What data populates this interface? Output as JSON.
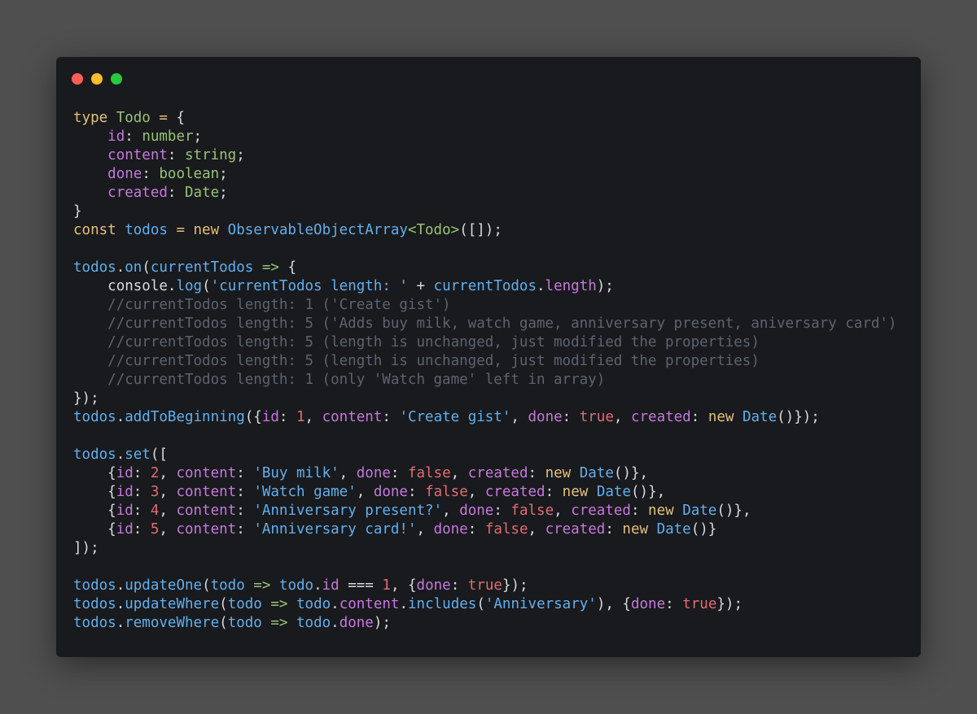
{
  "window": {
    "controls": [
      {
        "name": "close",
        "color": "#ff5f57"
      },
      {
        "name": "minimize",
        "color": "#febc2e"
      },
      {
        "name": "maximize",
        "color": "#28c840"
      }
    ]
  },
  "code": {
    "lines": [
      [
        [
          "kw",
          "type "
        ],
        [
          "tp",
          "Todo"
        ],
        [
          "kw",
          " = "
        ],
        [
          "pun",
          "{"
        ]
      ],
      [
        [
          "pun",
          "    "
        ],
        [
          "prop",
          "id"
        ],
        [
          "pun",
          ": "
        ],
        [
          "tp",
          "number"
        ],
        [
          "pun",
          ";"
        ]
      ],
      [
        [
          "pun",
          "    "
        ],
        [
          "prop",
          "content"
        ],
        [
          "pun",
          ": "
        ],
        [
          "tp",
          "string"
        ],
        [
          "pun",
          ";"
        ]
      ],
      [
        [
          "pun",
          "    "
        ],
        [
          "prop",
          "done"
        ],
        [
          "pun",
          ": "
        ],
        [
          "tp",
          "boolean"
        ],
        [
          "pun",
          ";"
        ]
      ],
      [
        [
          "pun",
          "    "
        ],
        [
          "prop",
          "created"
        ],
        [
          "pun",
          ": "
        ],
        [
          "tp",
          "Date"
        ],
        [
          "pun",
          ";"
        ]
      ],
      [
        [
          "pun",
          "}"
        ]
      ],
      [
        [
          "kw",
          "const "
        ],
        [
          "var",
          "todos"
        ],
        [
          "kw",
          " = new "
        ],
        [
          "cls",
          "ObservableObjectArray"
        ],
        [
          "op",
          "<"
        ],
        [
          "tp",
          "Todo"
        ],
        [
          "op",
          ">"
        ],
        [
          "pun",
          "([]);"
        ]
      ],
      [],
      [
        [
          "var",
          "todos"
        ],
        [
          "pun",
          "."
        ],
        [
          "fn",
          "on"
        ],
        [
          "pun",
          "("
        ],
        [
          "var",
          "currentTodos"
        ],
        [
          "op",
          " => "
        ],
        [
          "pun",
          "{"
        ]
      ],
      [
        [
          "pun",
          "    "
        ],
        [
          "txt",
          "console"
        ],
        [
          "pun",
          "."
        ],
        [
          "fn",
          "log"
        ],
        [
          "pun",
          "("
        ],
        [
          "str",
          "'currentTodos length: '"
        ],
        [
          "pun",
          " + "
        ],
        [
          "var",
          "currentTodos"
        ],
        [
          "pun",
          "."
        ],
        [
          "prop",
          "length"
        ],
        [
          "pun",
          ");"
        ]
      ],
      [
        [
          "pun",
          "    "
        ],
        [
          "com",
          "//currentTodos length: 1 ('Create gist')"
        ]
      ],
      [
        [
          "pun",
          "    "
        ],
        [
          "com",
          "//currentTodos length: 5 ('Adds buy milk, watch game, anniversary present, aniversary card')"
        ]
      ],
      [
        [
          "pun",
          "    "
        ],
        [
          "com",
          "//currentTodos length: 5 (length is unchanged, just modified the properties)"
        ]
      ],
      [
        [
          "pun",
          "    "
        ],
        [
          "com",
          "//currentTodos length: 5 (length is unchanged, just modified the properties)"
        ]
      ],
      [
        [
          "pun",
          "    "
        ],
        [
          "com",
          "//currentTodos length: 1 (only 'Watch game' left in array)"
        ]
      ],
      [
        [
          "pun",
          "});"
        ]
      ],
      [
        [
          "var",
          "todos"
        ],
        [
          "pun",
          "."
        ],
        [
          "fn",
          "addToBeginning"
        ],
        [
          "pun",
          "({"
        ],
        [
          "prop",
          "id"
        ],
        [
          "pun",
          ": "
        ],
        [
          "num",
          "1"
        ],
        [
          "pun",
          ", "
        ],
        [
          "prop",
          "content"
        ],
        [
          "pun",
          ": "
        ],
        [
          "str",
          "'Create gist'"
        ],
        [
          "pun",
          ", "
        ],
        [
          "prop",
          "done"
        ],
        [
          "pun",
          ": "
        ],
        [
          "bool",
          "true"
        ],
        [
          "pun",
          ", "
        ],
        [
          "prop",
          "created"
        ],
        [
          "pun",
          ": "
        ],
        [
          "kw",
          "new "
        ],
        [
          "cls",
          "Date"
        ],
        [
          "pun",
          "()});"
        ]
      ],
      [],
      [
        [
          "var",
          "todos"
        ],
        [
          "pun",
          "."
        ],
        [
          "fn",
          "set"
        ],
        [
          "pun",
          "(["
        ]
      ],
      [
        [
          "pun",
          "    {"
        ],
        [
          "prop",
          "id"
        ],
        [
          "pun",
          ": "
        ],
        [
          "num",
          "2"
        ],
        [
          "pun",
          ", "
        ],
        [
          "prop",
          "content"
        ],
        [
          "pun",
          ": "
        ],
        [
          "str",
          "'Buy milk'"
        ],
        [
          "pun",
          ", "
        ],
        [
          "prop",
          "done"
        ],
        [
          "pun",
          ": "
        ],
        [
          "bool",
          "false"
        ],
        [
          "pun",
          ", "
        ],
        [
          "prop",
          "created"
        ],
        [
          "pun",
          ": "
        ],
        [
          "kw",
          "new "
        ],
        [
          "cls",
          "Date"
        ],
        [
          "pun",
          "()},"
        ]
      ],
      [
        [
          "pun",
          "    {"
        ],
        [
          "prop",
          "id"
        ],
        [
          "pun",
          ": "
        ],
        [
          "num",
          "3"
        ],
        [
          "pun",
          ", "
        ],
        [
          "prop",
          "content"
        ],
        [
          "pun",
          ": "
        ],
        [
          "str",
          "'Watch game'"
        ],
        [
          "pun",
          ", "
        ],
        [
          "prop",
          "done"
        ],
        [
          "pun",
          ": "
        ],
        [
          "bool",
          "false"
        ],
        [
          "pun",
          ", "
        ],
        [
          "prop",
          "created"
        ],
        [
          "pun",
          ": "
        ],
        [
          "kw",
          "new "
        ],
        [
          "cls",
          "Date"
        ],
        [
          "pun",
          "()},"
        ]
      ],
      [
        [
          "pun",
          "    {"
        ],
        [
          "prop",
          "id"
        ],
        [
          "pun",
          ": "
        ],
        [
          "num",
          "4"
        ],
        [
          "pun",
          ", "
        ],
        [
          "prop",
          "content"
        ],
        [
          "pun",
          ": "
        ],
        [
          "str",
          "'Anniversary present?'"
        ],
        [
          "pun",
          ", "
        ],
        [
          "prop",
          "done"
        ],
        [
          "pun",
          ": "
        ],
        [
          "bool",
          "false"
        ],
        [
          "pun",
          ", "
        ],
        [
          "prop",
          "created"
        ],
        [
          "pun",
          ": "
        ],
        [
          "kw",
          "new "
        ],
        [
          "cls",
          "Date"
        ],
        [
          "pun",
          "()},"
        ]
      ],
      [
        [
          "pun",
          "    {"
        ],
        [
          "prop",
          "id"
        ],
        [
          "pun",
          ": "
        ],
        [
          "num",
          "5"
        ],
        [
          "pun",
          ", "
        ],
        [
          "prop",
          "content"
        ],
        [
          "pun",
          ": "
        ],
        [
          "str",
          "'Anniversary card!'"
        ],
        [
          "pun",
          ", "
        ],
        [
          "prop",
          "done"
        ],
        [
          "pun",
          ": "
        ],
        [
          "bool",
          "false"
        ],
        [
          "pun",
          ", "
        ],
        [
          "prop",
          "created"
        ],
        [
          "pun",
          ": "
        ],
        [
          "kw",
          "new "
        ],
        [
          "cls",
          "Date"
        ],
        [
          "pun",
          "()}"
        ]
      ],
      [
        [
          "pun",
          "]);"
        ]
      ],
      [],
      [
        [
          "var",
          "todos"
        ],
        [
          "pun",
          "."
        ],
        [
          "fn",
          "updateOne"
        ],
        [
          "pun",
          "("
        ],
        [
          "var",
          "todo"
        ],
        [
          "op",
          " => "
        ],
        [
          "var",
          "todo"
        ],
        [
          "pun",
          "."
        ],
        [
          "prop",
          "id"
        ],
        [
          "pun",
          " === "
        ],
        [
          "num",
          "1"
        ],
        [
          "pun",
          ", {"
        ],
        [
          "prop",
          "done"
        ],
        [
          "pun",
          ": "
        ],
        [
          "bool",
          "true"
        ],
        [
          "pun",
          "});"
        ]
      ],
      [
        [
          "var",
          "todos"
        ],
        [
          "pun",
          "."
        ],
        [
          "fn",
          "updateWhere"
        ],
        [
          "pun",
          "("
        ],
        [
          "var",
          "todo"
        ],
        [
          "op",
          " => "
        ],
        [
          "var",
          "todo"
        ],
        [
          "pun",
          "."
        ],
        [
          "prop",
          "content"
        ],
        [
          "pun",
          "."
        ],
        [
          "fn",
          "includes"
        ],
        [
          "pun",
          "("
        ],
        [
          "str",
          "'Anniversary'"
        ],
        [
          "pun",
          "), {"
        ],
        [
          "prop",
          "done"
        ],
        [
          "pun",
          ": "
        ],
        [
          "bool",
          "true"
        ],
        [
          "pun",
          "});"
        ]
      ],
      [
        [
          "var",
          "todos"
        ],
        [
          "pun",
          "."
        ],
        [
          "fn",
          "removeWhere"
        ],
        [
          "pun",
          "("
        ],
        [
          "var",
          "todo"
        ],
        [
          "op",
          " => "
        ],
        [
          "var",
          "todo"
        ],
        [
          "pun",
          "."
        ],
        [
          "prop",
          "done"
        ],
        [
          "pun",
          ");"
        ]
      ]
    ]
  }
}
